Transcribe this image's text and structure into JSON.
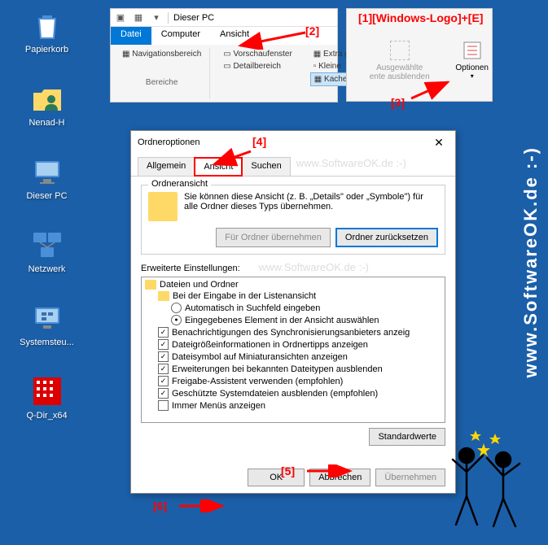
{
  "desktop": {
    "icons": [
      {
        "label": "Papierkorb",
        "name": "recycle-bin"
      },
      {
        "label": "Nenad-H",
        "name": "user-folder"
      },
      {
        "label": "Dieser PC",
        "name": "this-pc"
      },
      {
        "label": "Netzwerk",
        "name": "network"
      },
      {
        "label": "Systemsteu...",
        "name": "control-panel"
      },
      {
        "label": "Q-Dir_x64",
        "name": "qdir"
      }
    ]
  },
  "ribbon": {
    "title": "Dieser PC",
    "tabs": {
      "datei": "Datei",
      "computer": "Computer",
      "ansicht": "Ansicht"
    },
    "nav": "Navigationsbereich",
    "preview": "Vorschaufenster",
    "detail": "Detailbereich",
    "group_panes": "Bereiche",
    "extra": "Extra g",
    "kleine": "Kleine",
    "kacheln": "Kachel",
    "ausgewaehlte": "Ausgewählte",
    "ausblenden": "ente ausblenden",
    "optionen": "Optionen"
  },
  "dialog": {
    "title": "Ordneroptionen",
    "tabs": {
      "allgemein": "Allgemein",
      "ansicht": "Ansicht",
      "suchen": "Suchen"
    },
    "folder_view": {
      "title": "Ordneransicht",
      "text": "Sie können diese Ansicht (z. B. „Details\" oder „Symbole\") für alle Ordner dieses Typs übernehmen.",
      "apply_btn": "Für Ordner übernehmen",
      "reset_btn": "Ordner zurücksetzen"
    },
    "advanced_label": "Erweiterte Einstellungen:",
    "tree_items": [
      {
        "type": "folder",
        "indent": 0,
        "label": "Dateien und Ordner"
      },
      {
        "type": "folder",
        "indent": 1,
        "label": "Bei der Eingabe in der Listenansicht"
      },
      {
        "type": "radio",
        "indent": 2,
        "checked": false,
        "label": "Automatisch in Suchfeld eingeben"
      },
      {
        "type": "radio",
        "indent": 2,
        "checked": true,
        "label": "Eingegebenes Element in der Ansicht auswählen"
      },
      {
        "type": "check",
        "indent": 1,
        "checked": true,
        "label": "Benachrichtigungen des Synchronisierungsanbieters anzeig"
      },
      {
        "type": "check",
        "indent": 1,
        "checked": true,
        "label": "Dateigrößeinformationen in Ordnertipps anzeigen"
      },
      {
        "type": "check",
        "indent": 1,
        "checked": true,
        "label": "Dateisymbol auf Miniaturansichten anzeigen"
      },
      {
        "type": "check",
        "indent": 1,
        "checked": true,
        "label": "Erweiterungen bei bekannten Dateitypen ausblenden"
      },
      {
        "type": "check",
        "indent": 1,
        "checked": true,
        "label": "Freigabe-Assistent verwenden (empfohlen)"
      },
      {
        "type": "check",
        "indent": 1,
        "checked": true,
        "label": "Geschützte Systemdateien ausblenden (empfohlen)"
      },
      {
        "type": "check",
        "indent": 1,
        "checked": false,
        "label": "Immer Menüs anzeigen"
      }
    ],
    "defaults_btn": "Standardwerte",
    "ok_btn": "OK",
    "cancel_btn": "Abbrechen",
    "apply_btn": "Übernehmen"
  },
  "annotations": {
    "a1": "[1]",
    "a1_text": "[Windows-Logo]+[E]",
    "a2": "[2]",
    "a3": "[3]",
    "a4": "[4]",
    "a5": "[5]",
    "a6": "[6]"
  },
  "watermark": "www.SoftwareOK.de :-)"
}
